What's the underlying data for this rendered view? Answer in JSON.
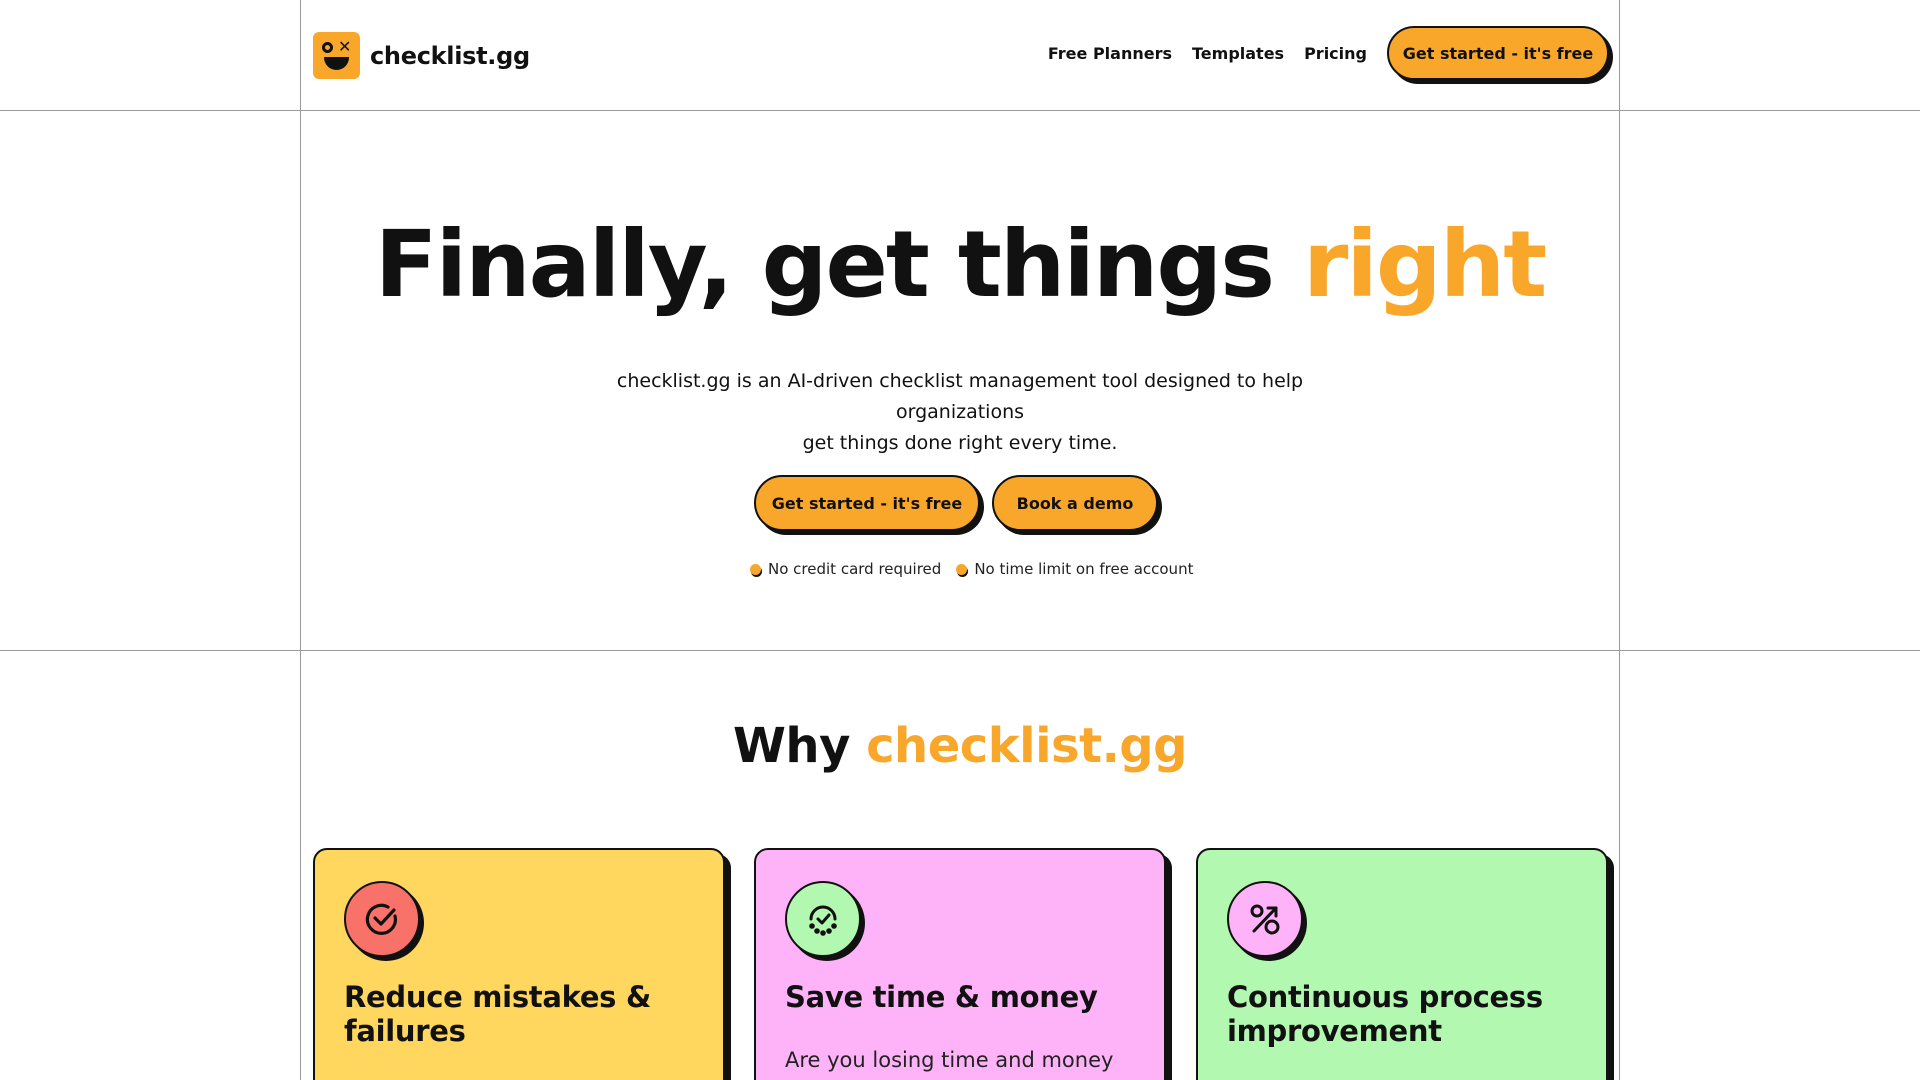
{
  "brand": {
    "name": "checklist.gg",
    "accent": "#f9a72b"
  },
  "nav": {
    "links": [
      "Free Planners",
      "Templates",
      "Pricing"
    ],
    "cta_label": "Get started - it's free"
  },
  "hero": {
    "title_main": "Finally, get things ",
    "title_accent": "right",
    "subtitle_line1": "checklist.gg is an AI-driven checklist management tool designed to help organizations",
    "subtitle_line2": "get things done right every time.",
    "primary_cta": "Get started - it's free",
    "secondary_cta": "Book a demo",
    "notes": [
      "No credit card required",
      "No time limit on free account"
    ]
  },
  "why": {
    "title_main": "Why ",
    "title_accent": "checklist.gg",
    "cards": [
      {
        "title": "Reduce mistakes & failures",
        "body": "",
        "icon": "check-circle-icon",
        "color": "#ffd75e"
      },
      {
        "title": "Save time & money",
        "body": "Are you losing time and money",
        "icon": "progress-check-icon",
        "color": "#feb3f9"
      },
      {
        "title": "Continuous process improvement",
        "body": "",
        "icon": "percent-arrow-icon",
        "color": "#b2f8b1"
      }
    ]
  }
}
